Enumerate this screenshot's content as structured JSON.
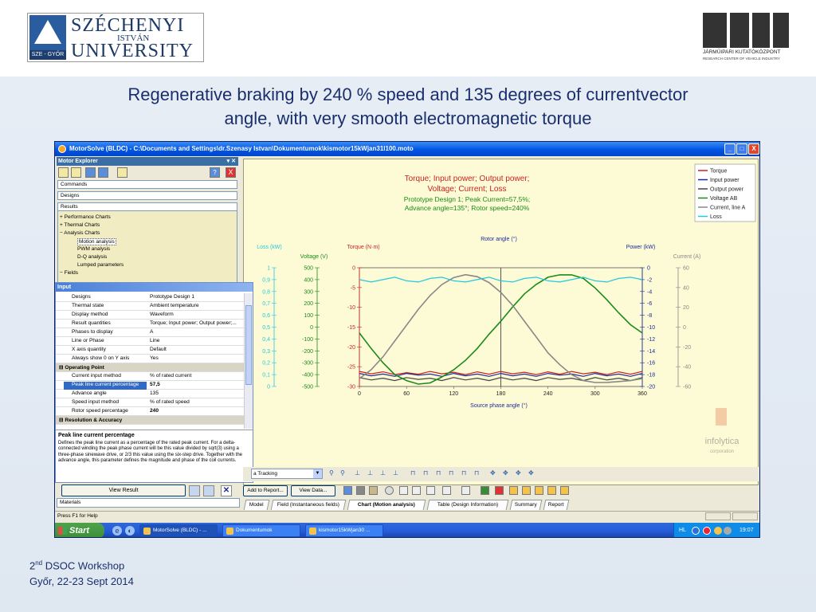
{
  "slide": {
    "title_line1": "Regenerative  braking  by 240 % speed and 135 degrees of currentvector",
    "title_line2": "angle, with very smooth electromagnetic torque",
    "footer_workshop_prefix": "2",
    "footer_workshop_sup": "nd",
    "footer_workshop_rest": " DSOC Workshop",
    "footer_place": "Győr, 22-23 Sept 2014"
  },
  "logos": {
    "sze_line1": "SZÉCHENYI",
    "sze_line2": "ISTVÁN",
    "sze_line3": "UNIVERSITY",
    "sze_tag": "SZE - GYŐR",
    "jkk_line1": "JÁRMŰIPARI KUTATÓKÖZPONT",
    "jkk_line2": "RESEARCH CENTER OF VEHICLE INDUSTRY"
  },
  "window": {
    "title": "MotorSolve (BLDC) - C:\\Documents and Settings\\dr.Szenasy Istvan\\Dokumentumok\\kismotor15kWjan31l100.moto",
    "btn_min": "_",
    "btn_max": "□",
    "btn_close": "X"
  },
  "explorer": {
    "header": "Motor Explorer",
    "pin": "▾ ✕",
    "help_icon": "?",
    "close_icon": "X",
    "buttons": [
      "Commands",
      "Designs",
      "Results"
    ],
    "tree": [
      {
        "label": "Performance Charts",
        "prefix": "+"
      },
      {
        "label": "Thermal Charts",
        "prefix": "+"
      },
      {
        "label": "Analysis Charts",
        "prefix": "−"
      },
      {
        "label": "Motion analysis",
        "prefix": ""
      },
      {
        "label": "PWM analysis",
        "prefix": ""
      },
      {
        "label": "D-Q analysis",
        "prefix": ""
      },
      {
        "label": "Lumped parameters",
        "prefix": ""
      },
      {
        "label": "Fields",
        "prefix": "−"
      }
    ]
  },
  "input_panel": {
    "header": "Input",
    "rows": [
      {
        "k": "Designs",
        "v": "Prototype Design 1"
      },
      {
        "k": "Thermal state",
        "v": "Ambient temperature"
      },
      {
        "k": "Display method",
        "v": "Waveform"
      },
      {
        "k": "Result quantities",
        "v": "Torque; Input power; Output power;..."
      },
      {
        "k": "Phases to display",
        "v": "A"
      },
      {
        "k": "Line or Phase",
        "v": "Line"
      },
      {
        "k": "X axis quantity",
        "v": "Default"
      },
      {
        "k": "Always show 0 on Y axis",
        "v": "Yes"
      }
    ],
    "section_operating": "Operating Point",
    "op_rows": [
      {
        "k": "Current input method",
        "v": "% of rated current"
      },
      {
        "k": "Peak line current percentage",
        "v": "57,5"
      },
      {
        "k": "Advance angle",
        "v": "135"
      },
      {
        "k": "Speed input method",
        "v": "% of rated speed"
      },
      {
        "k": "Rotor speed percentage",
        "v": "240"
      }
    ],
    "section_resolution": "Resolution & Accuracy",
    "desc_title": "Peak line current percentage",
    "desc_text": "Defines the peak line current as a percentage of the rated peak current. For a delta-connected winding the peak phase current will be this value divided by sqrt(3) using a three-phase sinewave drive, or 2/3 this value using the six-step drive. Together with the advance angle, this parameter defines the magnitude and phase of the coil currents.",
    "view_result": "View Result",
    "materials": "Materials"
  },
  "toolbar": {
    "combo_value": "a Tracking",
    "add_to_report": "Add to Report...",
    "view_data": "View Data...",
    "tabs": [
      {
        "label": "Model"
      },
      {
        "label": "Field (Instantaneous fields)"
      },
      {
        "label": "Chart (Motion analysis)"
      },
      {
        "label": "Table (Design Information)"
      },
      {
        "label": "Summary"
      },
      {
        "label": "Report"
      }
    ]
  },
  "status": {
    "text": "Press F1 for Help"
  },
  "taskbar": {
    "start": "Start",
    "tasks": [
      "MotorSolve (BLDC) - ...",
      "Dokumentumok",
      "kismotor15kWjan30 ..."
    ],
    "lang": "HL",
    "clock": "19:07"
  },
  "chart_data": {
    "type": "line",
    "title_line1": "Torque; Input power; Output power;",
    "title_line2": "Voltage; Current; Loss",
    "subtitle_line1": "Prototype Design 1; Peak Current=57,5%;",
    "subtitle_line2": "Advance angle=135°; Rotor speed=240%",
    "top_axis_label": "Rotor angle (°)",
    "xlabel": "Source phase angle (°)",
    "x_ticks": [
      0,
      60,
      120,
      180,
      240,
      300,
      360
    ],
    "xlim": [
      0,
      360
    ],
    "cursor_x": 180,
    "watermark": "infolytica",
    "watermark_sub": "corporation",
    "colors": {
      "torque": "#cc2222",
      "input_power": "#1a2a9a",
      "output_power": "#444444",
      "voltage": "#1a8a1a",
      "current": "#888888",
      "loss": "#22c8e0"
    },
    "axes": {
      "loss": {
        "label": "Loss (kW)",
        "ticks": [
          "1",
          "0,9",
          "0,8",
          "0,7",
          "0,6",
          "0,5",
          "0,4",
          "0,3",
          "0,2",
          "0,1",
          "0"
        ],
        "ylim": [
          0,
          1
        ]
      },
      "voltage": {
        "label": "Voltage (V)",
        "ticks": [
          "500",
          "400",
          "300",
          "200",
          "100",
          "0",
          "-100",
          "-200",
          "-300",
          "-400",
          "-500"
        ],
        "ylim": [
          -500,
          500
        ]
      },
      "torque": {
        "label": "Torque (N·m)",
        "ticks": [
          "0",
          "-5",
          "-10",
          "-15",
          "-20",
          "-25",
          "-30"
        ],
        "ylim": [
          -30,
          0
        ]
      },
      "power": {
        "label": "Power (kW)",
        "ticks": [
          "0",
          "-2",
          "-4",
          "-6",
          "-8",
          "-10",
          "-12",
          "-14",
          "-16",
          "-18",
          "-20"
        ],
        "ylim": [
          -20,
          0
        ]
      },
      "current": {
        "label": "Current (A)",
        "ticks": [
          "60",
          "40",
          "20",
          "0",
          "-20",
          "-40",
          "-60"
        ],
        "ylim": [
          -60,
          60
        ]
      }
    },
    "legend": [
      "Torque",
      "Input power",
      "Output power",
      "Voltage AB",
      "Current, line A",
      "Loss"
    ],
    "legend_placement": "top-right",
    "series": [
      {
        "name": "Torque",
        "axis": "torque",
        "x": [
          0,
          15,
          30,
          45,
          60,
          75,
          90,
          105,
          120,
          135,
          150,
          165,
          180,
          195,
          210,
          225,
          240,
          255,
          270,
          285,
          300,
          315,
          330,
          345,
          360
        ],
        "values": [
          -26.2,
          -26.8,
          -26.3,
          -27,
          -26.5,
          -26.9,
          -26.2,
          -26.8,
          -26.4,
          -27,
          -26.3,
          -26.9,
          -26.2,
          -26.8,
          -26.4,
          -27,
          -26.3,
          -26.9,
          -26.2,
          -26.8,
          -26.4,
          -27,
          -26.3,
          -26.9,
          -26.2
        ]
      },
      {
        "name": "Input power",
        "axis": "power",
        "x": [
          0,
          15,
          30,
          45,
          60,
          75,
          90,
          105,
          120,
          135,
          150,
          165,
          180,
          195,
          210,
          225,
          240,
          255,
          270,
          285,
          300,
          315,
          330,
          345,
          360
        ],
        "values": [
          -17.8,
          -18.2,
          -17.9,
          -18.3,
          -17.8,
          -18.1,
          -17.9,
          -18.3,
          -17.8,
          -18.2,
          -17.9,
          -18.3,
          -17.8,
          -18.2,
          -17.9,
          -18.3,
          -17.8,
          -18.1,
          -17.9,
          -18.3,
          -17.8,
          -18.2,
          -17.9,
          -18.3,
          -17.8
        ]
      },
      {
        "name": "Output power",
        "axis": "power",
        "x": [
          0,
          15,
          30,
          45,
          60,
          75,
          90,
          105,
          120,
          135,
          150,
          165,
          180,
          195,
          210,
          225,
          240,
          255,
          270,
          285,
          300,
          315,
          330,
          345,
          360
        ],
        "values": [
          -18.5,
          -18.9,
          -18.6,
          -19,
          -18.5,
          -18.8,
          -18.6,
          -19,
          -18.5,
          -18.9,
          -18.6,
          -19,
          -18.5,
          -18.9,
          -18.6,
          -19,
          -18.5,
          -18.8,
          -18.6,
          -19,
          -18.5,
          -18.9,
          -18.6,
          -19,
          -18.5
        ]
      },
      {
        "name": "Voltage AB",
        "axis": "voltage",
        "x": [
          0,
          15,
          30,
          45,
          60,
          75,
          90,
          105,
          120,
          135,
          150,
          165,
          180,
          195,
          210,
          225,
          240,
          255,
          270,
          285,
          300,
          315,
          330,
          345,
          360
        ],
        "values": [
          -50,
          -180,
          -300,
          -400,
          -450,
          -480,
          -470,
          -420,
          -360,
          -280,
          -180,
          -60,
          50,
          170,
          280,
          360,
          420,
          440,
          440,
          410,
          330,
          230,
          120,
          20,
          -50
        ]
      },
      {
        "name": "Current, line A",
        "axis": "current",
        "x": [
          0,
          15,
          30,
          45,
          60,
          75,
          90,
          105,
          120,
          135,
          150,
          165,
          180,
          195,
          210,
          225,
          240,
          255,
          270,
          285,
          300,
          315,
          330,
          345,
          360
        ],
        "values": [
          -52,
          -43,
          -30,
          -14,
          2,
          18,
          32,
          43,
          50,
          53,
          51,
          45,
          35,
          22,
          6,
          -10,
          -26,
          -38,
          -48,
          -54,
          -56,
          -56,
          -55,
          -54,
          -52
        ]
      },
      {
        "name": "Loss",
        "axis": "loss",
        "x": [
          0,
          15,
          30,
          45,
          60,
          75,
          90,
          105,
          120,
          135,
          150,
          165,
          180,
          195,
          210,
          225,
          240,
          255,
          270,
          285,
          300,
          315,
          330,
          345,
          360
        ],
        "values": [
          0.9,
          0.88,
          0.9,
          0.92,
          0.89,
          0.88,
          0.91,
          0.92,
          0.89,
          0.88,
          0.9,
          0.92,
          0.89,
          0.88,
          0.91,
          0.92,
          0.89,
          0.88,
          0.9,
          0.92,
          0.89,
          0.88,
          0.91,
          0.92,
          0.9
        ]
      }
    ]
  }
}
